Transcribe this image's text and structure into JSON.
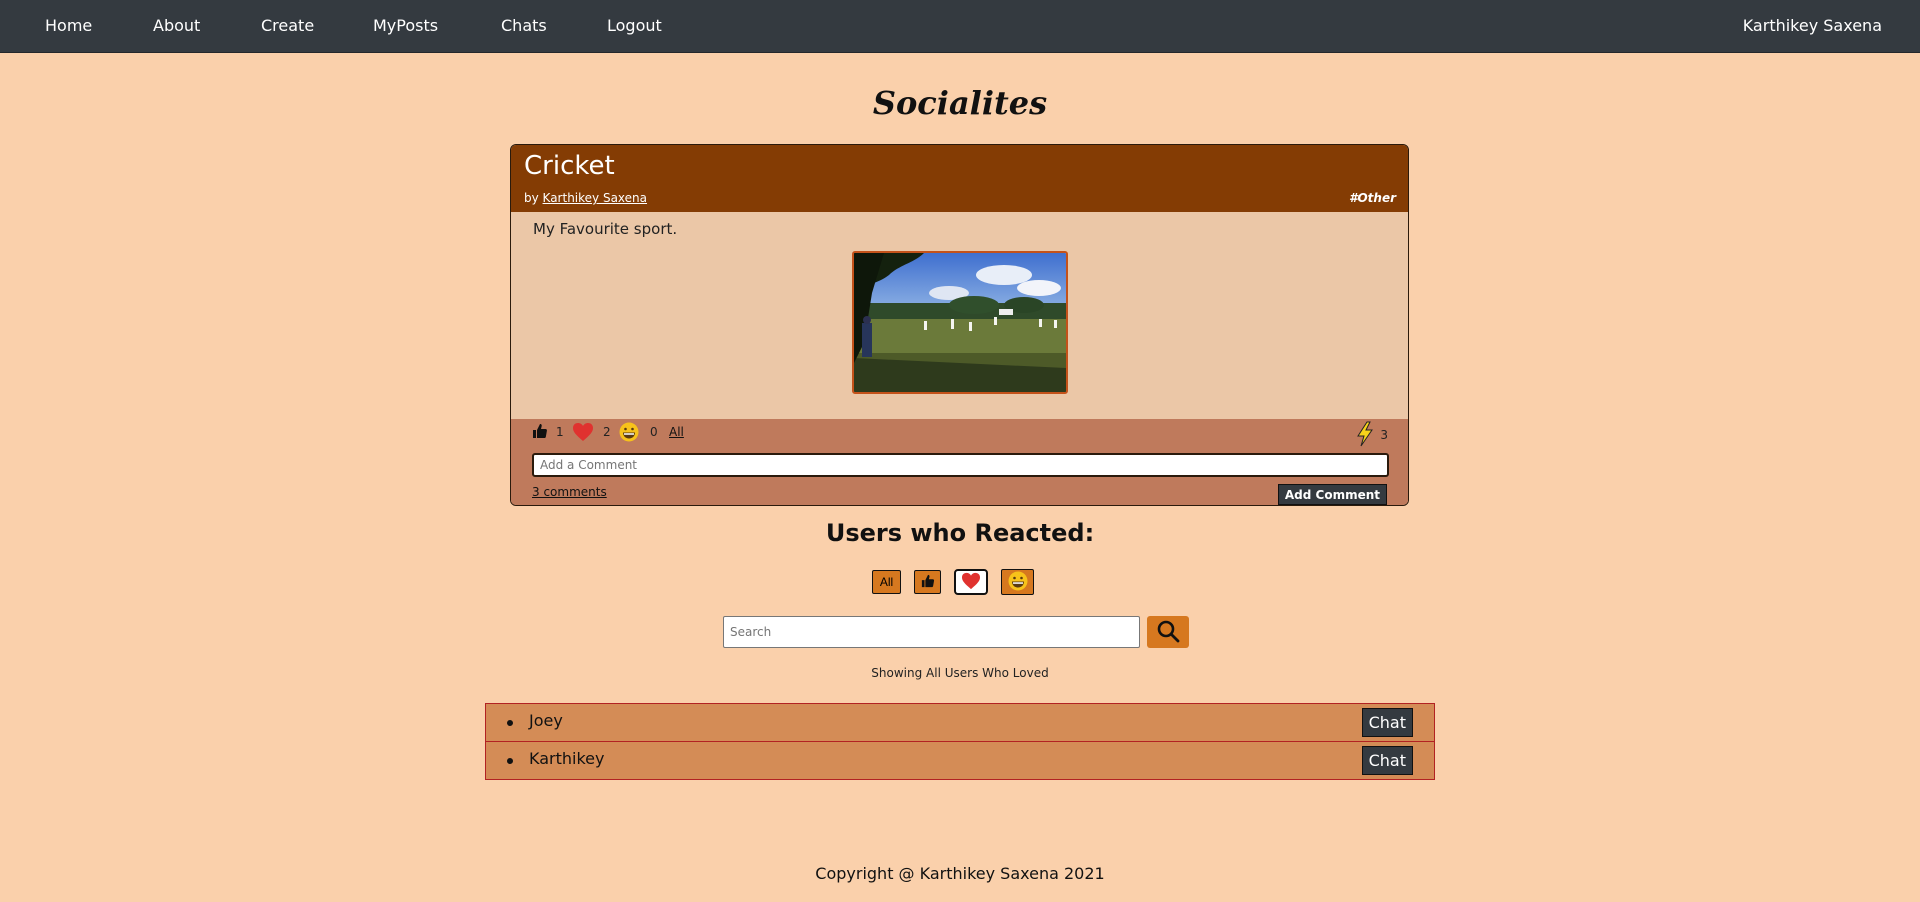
{
  "nav": {
    "items": [
      "Home",
      "About",
      "Create",
      "MyPosts",
      "Chats",
      "Logout"
    ],
    "user": "Karthikey Saxena"
  },
  "site_title": "Socialites",
  "post": {
    "title": "Cricket",
    "by_label": "by",
    "author": "Karthikey Saxena",
    "tag": "#Other",
    "text": "My Favourite sport.",
    "reactions": {
      "like_count": "1",
      "love_count": "2",
      "laugh_count": "0",
      "all_label": "All",
      "bolt_count": "3"
    },
    "comment_placeholder": "Add a Comment",
    "comments_link": "3 comments",
    "add_comment_label": "Add Comment"
  },
  "reacted": {
    "title": "Users who Reacted:",
    "filters": {
      "all_label": "All"
    },
    "search_placeholder": "Search",
    "showing_text": "Showing All Users Who Loved",
    "users": [
      {
        "name": "Joey",
        "chat_label": "Chat"
      },
      {
        "name": "Karthikey",
        "chat_label": "Chat"
      }
    ]
  },
  "footer": {
    "copyright": "Copyright @ Karthikey Saxena 2021"
  },
  "colors": {
    "background": "#fad0ab",
    "navbar": "#343a40",
    "post_header": "#843c04",
    "post_body": "#ebc7a7",
    "post_footer": "#bf7a5c",
    "accent": "#d6781f",
    "list_item": "#d48c56",
    "heart": "#e0322f"
  },
  "icons": {
    "like": "thumbs-up-icon",
    "love": "heart-icon",
    "laugh": "grinning-face-icon",
    "bolt": "lightning-icon",
    "search": "magnifier-icon"
  }
}
